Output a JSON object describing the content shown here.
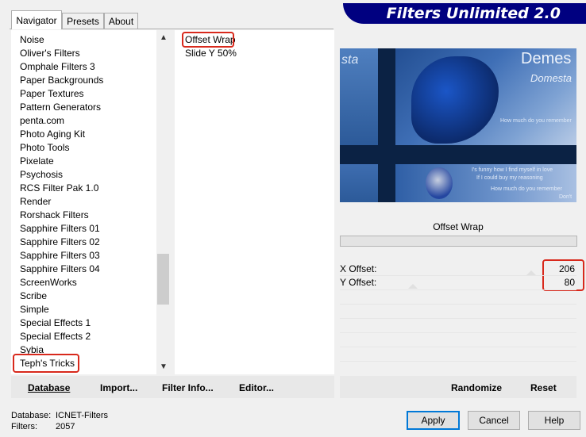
{
  "tabs": [
    "Navigator",
    "Presets",
    "About"
  ],
  "banner": "Filters Unlimited 2.0",
  "categories": [
    "Noise",
    "Oliver's Filters",
    "Omphale Filters 3",
    "Paper Backgrounds",
    "Paper Textures",
    "Pattern Generators",
    "penta.com",
    "Photo Aging Kit",
    "Photo Tools",
    "Pixelate",
    "Psychosis",
    "RCS Filter Pak 1.0",
    "Render",
    "Rorshack Filters",
    "Sapphire Filters 01",
    "Sapphire Filters 02",
    "Sapphire Filters 03",
    "Sapphire Filters 04",
    "ScreenWorks",
    "Scribe",
    "Simple",
    "Special Effects 1",
    "Special Effects 2",
    "Sybia",
    "Teph's Tricks"
  ],
  "filters": [
    "Offset Wrap",
    "Slide Y 50%"
  ],
  "preview": {
    "brand_text_1": "Demes",
    "brand_text_2": "Domesta",
    "brand_text_left": "sta",
    "script_line_1": "I's funny how I find myself in love",
    "script_line_2": "If I could buy my reasoning",
    "script_line_3": "How much do you remember",
    "script_line_4": "Don't"
  },
  "filter_title": "Offset Wrap",
  "params": [
    {
      "label": "X Offset:",
      "value": "206"
    },
    {
      "label": "Y Offset:",
      "value": "80"
    }
  ],
  "left_buttons": {
    "database": "Database",
    "import": "Import...",
    "filter_info": "Filter Info...",
    "editor": "Editor..."
  },
  "right_buttons": {
    "randomize": "Randomize",
    "reset": "Reset"
  },
  "status": {
    "database_label": "Database:",
    "database_value": "ICNET-Filters",
    "filters_label": "Filters:",
    "filters_value": "2057"
  },
  "dialog_buttons": {
    "apply": "Apply",
    "cancel": "Cancel",
    "help": "Help"
  },
  "colors": {
    "accent_red": "#d8291c",
    "banner_blue": "#000080",
    "default_border": "#0078d7"
  }
}
